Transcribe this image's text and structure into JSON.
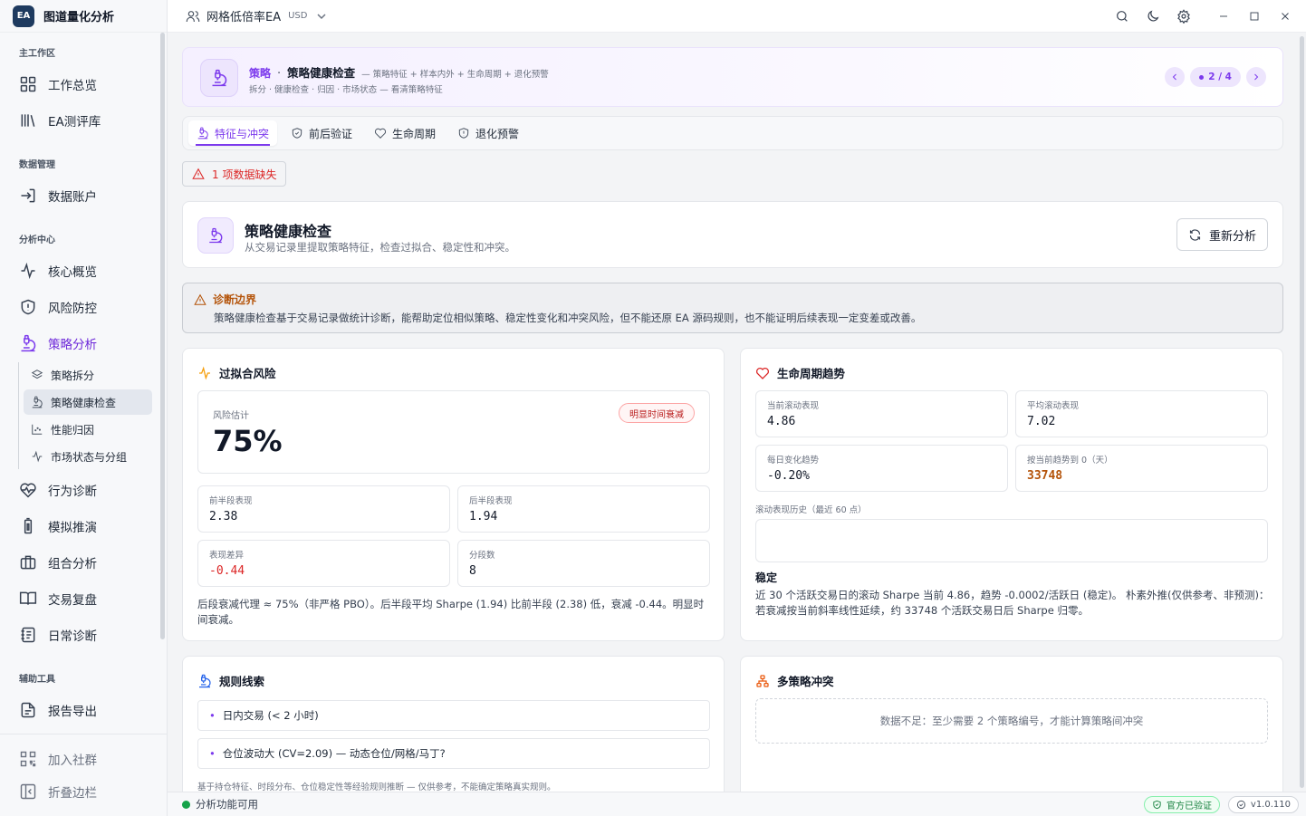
{
  "app": {
    "name": "图道量化分析",
    "logo_text": "EA"
  },
  "topbar": {
    "ea_name": "网格低倍率EA",
    "currency": "USD"
  },
  "sidebar": {
    "sections": {
      "main": "主工作区",
      "data": "数据管理",
      "analysis": "分析中心",
      "tools": "辅助工具"
    },
    "items": {
      "overview": "工作总览",
      "ea_library": "EA测评库",
      "data_account": "数据账户",
      "core": "核心概览",
      "risk": "风险防控",
      "strategy": "策略分析",
      "behavior": "行为诊断",
      "simulation": "模拟推演",
      "portfolio": "组合分析",
      "review": "交易复盘",
      "daily": "日常诊断",
      "report": "报告导出"
    },
    "sub_items": {
      "split": "策略拆分",
      "health": "策略健康检查",
      "attribution": "性能归因",
      "market": "市场状态与分组"
    },
    "bottom": {
      "community": "加入社群",
      "collapse": "折叠边栏"
    }
  },
  "hero": {
    "kicker": "策略",
    "separator": "·",
    "title": "策略健康检查",
    "desc": "— 策略特征 + 样本内外 + 生命周期 + 退化预警",
    "line2": "拆分 · 健康检查 · 归因 · 市场状态 — 看清策略特征",
    "pager": "2 / 4"
  },
  "tabs": [
    "特征与冲突",
    "前后验证",
    "生命周期",
    "退化预警"
  ],
  "missing_badge": "1 项数据缺失",
  "header": {
    "title": "策略健康检查",
    "subtitle": "从交易记录里提取策略特征，检查过拟合、稳定性和冲突。",
    "refresh": "重新分析"
  },
  "boundary": {
    "title": "诊断边界",
    "text": "策略健康检查基于交易记录做统计诊断，能帮助定位相似策略、稳定性变化和冲突风险，但不能还原 EA 源码规则，也不能证明后续表现一定变差或改善。"
  },
  "overfit": {
    "title": "过拟合风险",
    "risk_label": "风险估计",
    "risk_value": "75%",
    "badge": "明显时间衰减",
    "stats": {
      "first_label": "前半段表现",
      "first_value": "2.38",
      "second_label": "后半段表现",
      "second_value": "1.94",
      "diff_label": "表现差异",
      "diff_value": "-0.44",
      "segments_label": "分段数",
      "segments_value": "8"
    },
    "note": "后段衰减代理 ≈ 75%（非严格 PBO）。后半段平均 Sharpe (1.94) 比前半段 (2.38) 低，衰减 -0.44。明显时间衰减。"
  },
  "lifecycle": {
    "title": "生命周期趋势",
    "stats": {
      "current_label": "当前滚动表现",
      "current_value": "4.86",
      "avg_label": "平均滚动表现",
      "avg_value": "7.02",
      "trend_label": "每日变化趋势",
      "trend_value": "-0.20%",
      "zero_label": "按当前趋势到 0（天）",
      "zero_value": "33748"
    },
    "chart_label": "滚动表现历史（最近 60 点）",
    "status_title": "稳定",
    "status_text": "近 30 个活跃交易日的滚动 Sharpe 当前 4.86，趋势 -0.0002/活跃日 (稳定)。 朴素外推(仅供参考、非预测)：若衰减按当前斜率线性延续，约 33748 个活跃交易日后 Sharpe 归零。"
  },
  "rules": {
    "title": "规则线索",
    "items": [
      "日内交易 (< 2 小时)",
      "仓位波动大 (CV=2.09) — 动态仓位/网格/马丁?"
    ],
    "note": "基于持仓特征、时段分布、仓位稳定性等经验规则推断 — 仅供参考，不能确定策略真实规则。"
  },
  "conflict": {
    "title": "多策略冲突",
    "empty": "数据不足：至少需要 2 个策略编号，才能计算策略间冲突"
  },
  "statusbar": {
    "status": "分析功能可用",
    "verified": "官方已验证",
    "version": "v1.0.110"
  },
  "colors": {
    "accent": "#7c3aed",
    "danger": "#dc2626",
    "warning": "#b45309",
    "success": "#16a34a"
  }
}
